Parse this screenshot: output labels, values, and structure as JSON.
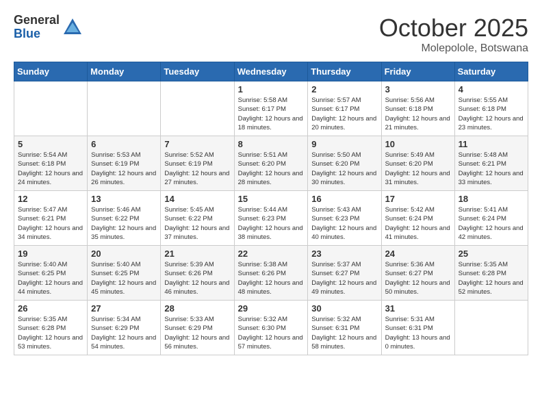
{
  "header": {
    "logo_general": "General",
    "logo_blue": "Blue",
    "month": "October 2025",
    "location": "Molepolole, Botswana"
  },
  "weekdays": [
    "Sunday",
    "Monday",
    "Tuesday",
    "Wednesday",
    "Thursday",
    "Friday",
    "Saturday"
  ],
  "weeks": [
    [
      {
        "day": "",
        "sunrise": "",
        "sunset": "",
        "daylight": ""
      },
      {
        "day": "",
        "sunrise": "",
        "sunset": "",
        "daylight": ""
      },
      {
        "day": "",
        "sunrise": "",
        "sunset": "",
        "daylight": ""
      },
      {
        "day": "1",
        "sunrise": "Sunrise: 5:58 AM",
        "sunset": "Sunset: 6:17 PM",
        "daylight": "Daylight: 12 hours and 18 minutes."
      },
      {
        "day": "2",
        "sunrise": "Sunrise: 5:57 AM",
        "sunset": "Sunset: 6:17 PM",
        "daylight": "Daylight: 12 hours and 20 minutes."
      },
      {
        "day": "3",
        "sunrise": "Sunrise: 5:56 AM",
        "sunset": "Sunset: 6:18 PM",
        "daylight": "Daylight: 12 hours and 21 minutes."
      },
      {
        "day": "4",
        "sunrise": "Sunrise: 5:55 AM",
        "sunset": "Sunset: 6:18 PM",
        "daylight": "Daylight: 12 hours and 23 minutes."
      }
    ],
    [
      {
        "day": "5",
        "sunrise": "Sunrise: 5:54 AM",
        "sunset": "Sunset: 6:18 PM",
        "daylight": "Daylight: 12 hours and 24 minutes."
      },
      {
        "day": "6",
        "sunrise": "Sunrise: 5:53 AM",
        "sunset": "Sunset: 6:19 PM",
        "daylight": "Daylight: 12 hours and 26 minutes."
      },
      {
        "day": "7",
        "sunrise": "Sunrise: 5:52 AM",
        "sunset": "Sunset: 6:19 PM",
        "daylight": "Daylight: 12 hours and 27 minutes."
      },
      {
        "day": "8",
        "sunrise": "Sunrise: 5:51 AM",
        "sunset": "Sunset: 6:20 PM",
        "daylight": "Daylight: 12 hours and 28 minutes."
      },
      {
        "day": "9",
        "sunrise": "Sunrise: 5:50 AM",
        "sunset": "Sunset: 6:20 PM",
        "daylight": "Daylight: 12 hours and 30 minutes."
      },
      {
        "day": "10",
        "sunrise": "Sunrise: 5:49 AM",
        "sunset": "Sunset: 6:20 PM",
        "daylight": "Daylight: 12 hours and 31 minutes."
      },
      {
        "day": "11",
        "sunrise": "Sunrise: 5:48 AM",
        "sunset": "Sunset: 6:21 PM",
        "daylight": "Daylight: 12 hours and 33 minutes."
      }
    ],
    [
      {
        "day": "12",
        "sunrise": "Sunrise: 5:47 AM",
        "sunset": "Sunset: 6:21 PM",
        "daylight": "Daylight: 12 hours and 34 minutes."
      },
      {
        "day": "13",
        "sunrise": "Sunrise: 5:46 AM",
        "sunset": "Sunset: 6:22 PM",
        "daylight": "Daylight: 12 hours and 35 minutes."
      },
      {
        "day": "14",
        "sunrise": "Sunrise: 5:45 AM",
        "sunset": "Sunset: 6:22 PM",
        "daylight": "Daylight: 12 hours and 37 minutes."
      },
      {
        "day": "15",
        "sunrise": "Sunrise: 5:44 AM",
        "sunset": "Sunset: 6:23 PM",
        "daylight": "Daylight: 12 hours and 38 minutes."
      },
      {
        "day": "16",
        "sunrise": "Sunrise: 5:43 AM",
        "sunset": "Sunset: 6:23 PM",
        "daylight": "Daylight: 12 hours and 40 minutes."
      },
      {
        "day": "17",
        "sunrise": "Sunrise: 5:42 AM",
        "sunset": "Sunset: 6:24 PM",
        "daylight": "Daylight: 12 hours and 41 minutes."
      },
      {
        "day": "18",
        "sunrise": "Sunrise: 5:41 AM",
        "sunset": "Sunset: 6:24 PM",
        "daylight": "Daylight: 12 hours and 42 minutes."
      }
    ],
    [
      {
        "day": "19",
        "sunrise": "Sunrise: 5:40 AM",
        "sunset": "Sunset: 6:25 PM",
        "daylight": "Daylight: 12 hours and 44 minutes."
      },
      {
        "day": "20",
        "sunrise": "Sunrise: 5:40 AM",
        "sunset": "Sunset: 6:25 PM",
        "daylight": "Daylight: 12 hours and 45 minutes."
      },
      {
        "day": "21",
        "sunrise": "Sunrise: 5:39 AM",
        "sunset": "Sunset: 6:26 PM",
        "daylight": "Daylight: 12 hours and 46 minutes."
      },
      {
        "day": "22",
        "sunrise": "Sunrise: 5:38 AM",
        "sunset": "Sunset: 6:26 PM",
        "daylight": "Daylight: 12 hours and 48 minutes."
      },
      {
        "day": "23",
        "sunrise": "Sunrise: 5:37 AM",
        "sunset": "Sunset: 6:27 PM",
        "daylight": "Daylight: 12 hours and 49 minutes."
      },
      {
        "day": "24",
        "sunrise": "Sunrise: 5:36 AM",
        "sunset": "Sunset: 6:27 PM",
        "daylight": "Daylight: 12 hours and 50 minutes."
      },
      {
        "day": "25",
        "sunrise": "Sunrise: 5:35 AM",
        "sunset": "Sunset: 6:28 PM",
        "daylight": "Daylight: 12 hours and 52 minutes."
      }
    ],
    [
      {
        "day": "26",
        "sunrise": "Sunrise: 5:35 AM",
        "sunset": "Sunset: 6:28 PM",
        "daylight": "Daylight: 12 hours and 53 minutes."
      },
      {
        "day": "27",
        "sunrise": "Sunrise: 5:34 AM",
        "sunset": "Sunset: 6:29 PM",
        "daylight": "Daylight: 12 hours and 54 minutes."
      },
      {
        "day": "28",
        "sunrise": "Sunrise: 5:33 AM",
        "sunset": "Sunset: 6:29 PM",
        "daylight": "Daylight: 12 hours and 56 minutes."
      },
      {
        "day": "29",
        "sunrise": "Sunrise: 5:32 AM",
        "sunset": "Sunset: 6:30 PM",
        "daylight": "Daylight: 12 hours and 57 minutes."
      },
      {
        "day": "30",
        "sunrise": "Sunrise: 5:32 AM",
        "sunset": "Sunset: 6:31 PM",
        "daylight": "Daylight: 12 hours and 58 minutes."
      },
      {
        "day": "31",
        "sunrise": "Sunrise: 5:31 AM",
        "sunset": "Sunset: 6:31 PM",
        "daylight": "Daylight: 13 hours and 0 minutes."
      },
      {
        "day": "",
        "sunrise": "",
        "sunset": "",
        "daylight": ""
      }
    ]
  ]
}
